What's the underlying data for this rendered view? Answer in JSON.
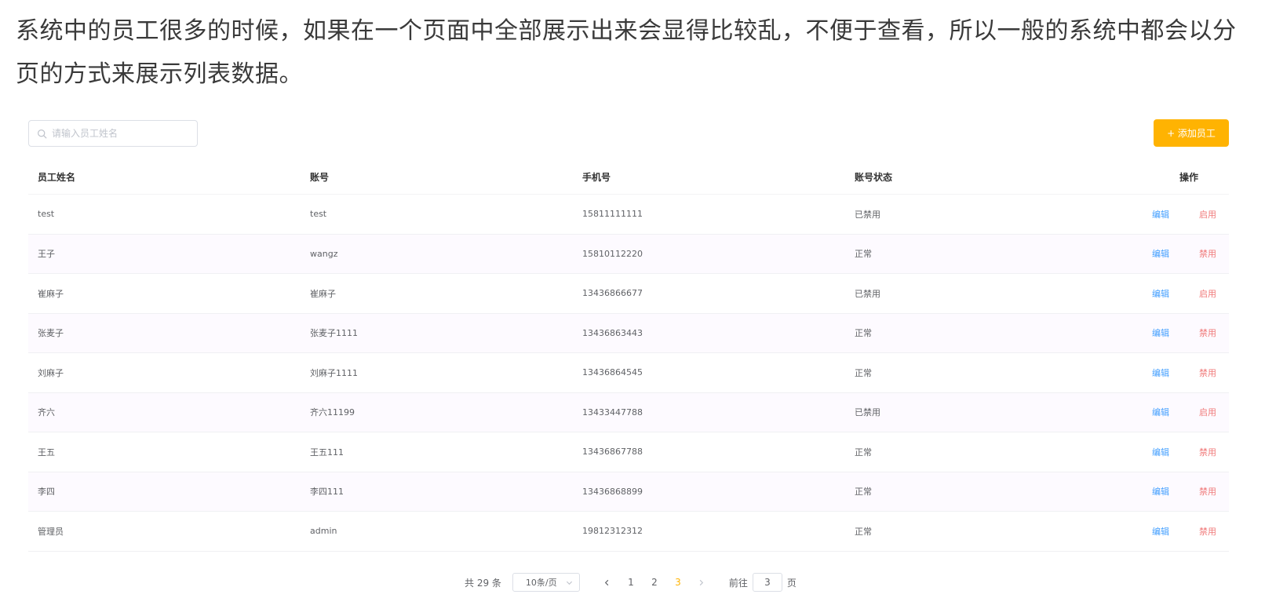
{
  "intro": "系统中的员工很多的时候，如果在一个页面中全部展示出来会显得比较乱，不便于查看，所以一般的系统中都会以分页的方式来展示列表数据。",
  "search": {
    "placeholder": "请输入员工姓名",
    "icon": "search-icon"
  },
  "add_button": {
    "label": "+ 添加员工"
  },
  "table": {
    "headers": [
      "员工姓名",
      "账号",
      "手机号",
      "账号状态",
      "操作"
    ],
    "rows": [
      {
        "name": "test",
        "account": "test",
        "phone": "15811111111",
        "status": "已禁用",
        "edit": "编辑",
        "toggle": "启用"
      },
      {
        "name": "王子",
        "account": "wangz",
        "phone": "15810112220",
        "status": "正常",
        "edit": "编辑",
        "toggle": "禁用"
      },
      {
        "name": "崔麻子",
        "account": "崔麻子",
        "phone": "13436866677",
        "status": "已禁用",
        "edit": "编辑",
        "toggle": "启用"
      },
      {
        "name": "张麦子",
        "account": "张麦子1111",
        "phone": "13436863443",
        "status": "正常",
        "edit": "编辑",
        "toggle": "禁用"
      },
      {
        "name": "刘麻子",
        "account": "刘麻子1111",
        "phone": "13436864545",
        "status": "正常",
        "edit": "编辑",
        "toggle": "禁用"
      },
      {
        "name": "齐六",
        "account": "齐六11199",
        "phone": "13433447788",
        "status": "已禁用",
        "edit": "编辑",
        "toggle": "启用"
      },
      {
        "name": "王五",
        "account": "王五111",
        "phone": "13436867788",
        "status": "正常",
        "edit": "编辑",
        "toggle": "禁用"
      },
      {
        "name": "李四",
        "account": "李四111",
        "phone": "13436868899",
        "status": "正常",
        "edit": "编辑",
        "toggle": "禁用"
      },
      {
        "name": "管理员",
        "account": "admin",
        "phone": "19812312312",
        "status": "正常",
        "edit": "编辑",
        "toggle": "禁用"
      }
    ]
  },
  "pagination": {
    "total": "共 29 条",
    "page_size": "10条/页",
    "pages": [
      "1",
      "2",
      "3"
    ],
    "current": "3",
    "goto_prefix": "前往",
    "goto_value": "3",
    "goto_suffix": "页"
  },
  "colors": {
    "accent": "#ffb302",
    "link": "#419eff",
    "danger": "#f07a7a"
  }
}
